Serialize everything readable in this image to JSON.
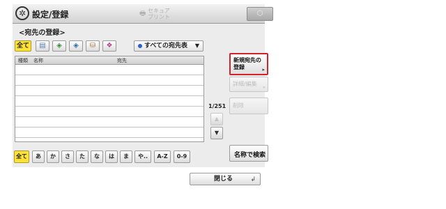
{
  "header": {
    "title": "設定/登録",
    "secure_print_label": "セキュア\nプリント",
    "header_button_glyph": "⬡"
  },
  "screen": {
    "title": "<宛先の登録>"
  },
  "filters": {
    "all_label": "全て",
    "icons": [
      "card-icon",
      "group-icon",
      "group-icon-2",
      "person-icon",
      "books-icon"
    ],
    "icon_glyphs": [
      "▤",
      "◈",
      "◈",
      "⛁",
      "❖"
    ]
  },
  "address_book_select": {
    "value": "すべての宛先表",
    "arrow": "▼"
  },
  "list": {
    "columns": {
      "type": "種類",
      "name": "名称",
      "destination": "宛先"
    },
    "rows": [
      "",
      "",
      "",
      "",
      "",
      "",
      ""
    ]
  },
  "pagination": {
    "counter": "1/251",
    "up": "▲",
    "down": "▼"
  },
  "side_buttons": {
    "new_address": "新規宛先の\n登録",
    "details_edit": "詳細/編集",
    "delete": "削除",
    "search_by_name": "名称で検索"
  },
  "kana_tabs": [
    "全て",
    "あ",
    "か",
    "さ",
    "た",
    "な",
    "は",
    "ま",
    "や..",
    "A-Z",
    "0-9"
  ],
  "footer": {
    "close": "閉じる",
    "close_glyph": "↲"
  }
}
